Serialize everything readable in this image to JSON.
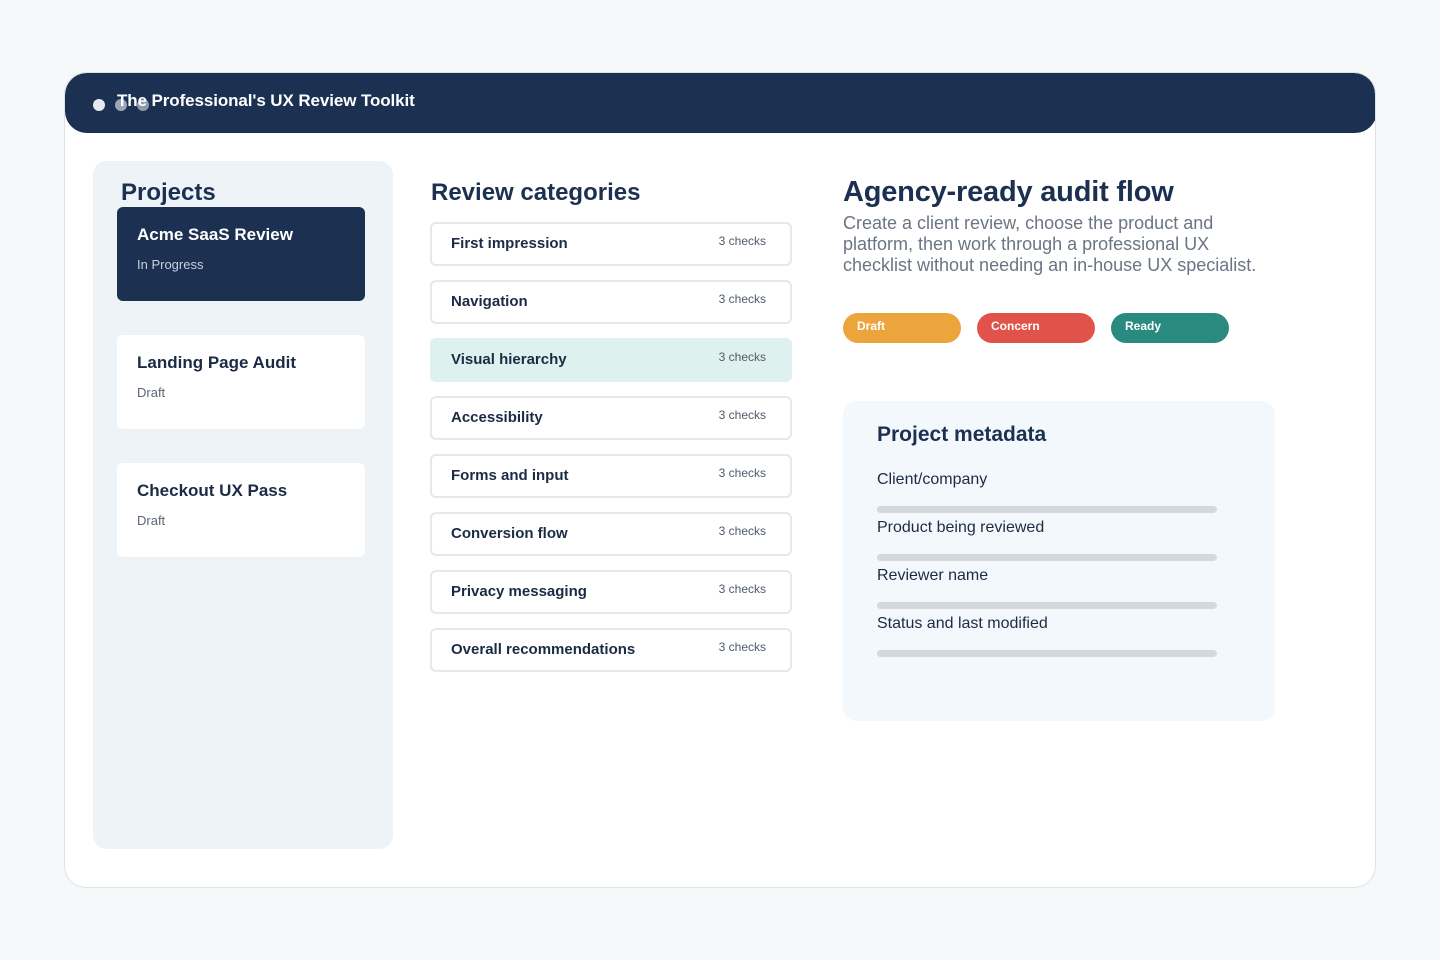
{
  "app": {
    "title": "The Professional's UX Review Toolkit"
  },
  "sidebar": {
    "heading": "Projects",
    "projects": [
      {
        "name": "Acme SaaS Review",
        "status": "In Progress",
        "active": true
      },
      {
        "name": "Landing Page Audit",
        "status": "Draft",
        "active": false
      },
      {
        "name": "Checkout UX Pass",
        "status": "Draft",
        "active": false
      }
    ]
  },
  "categories": {
    "heading": "Review categories",
    "items": [
      {
        "name": "First impression",
        "count": "3 checks"
      },
      {
        "name": "Navigation",
        "count": "3 checks"
      },
      {
        "name": "Visual hierarchy",
        "count": "3 checks",
        "selected": true
      },
      {
        "name": "Accessibility",
        "count": "3 checks"
      },
      {
        "name": "Forms and input",
        "count": "3 checks"
      },
      {
        "name": "Conversion flow",
        "count": "3 checks"
      },
      {
        "name": "Privacy messaging",
        "count": "3 checks"
      },
      {
        "name": "Overall recommendations",
        "count": "3 checks"
      }
    ]
  },
  "hero": {
    "title": "Agency-ready audit flow",
    "description": "Create a client review, choose the product and platform, then work through a professional UX checklist without needing an in-house UX specialist."
  },
  "status_badges": [
    {
      "label": "Draft",
      "color": "#eca53c"
    },
    {
      "label": "Concern",
      "color": "#e0534a"
    },
    {
      "label": "Ready",
      "color": "#2a8a80"
    }
  ],
  "metadata": {
    "heading": "Project metadata",
    "fields": [
      {
        "label": "Client/company"
      },
      {
        "label": "Product being reviewed"
      },
      {
        "label": "Reviewer name"
      },
      {
        "label": "Status and last modified"
      }
    ]
  },
  "colors": {
    "navy": "#1c3152",
    "selected_row": "#dff1ef",
    "background": "#f6f9fa"
  }
}
